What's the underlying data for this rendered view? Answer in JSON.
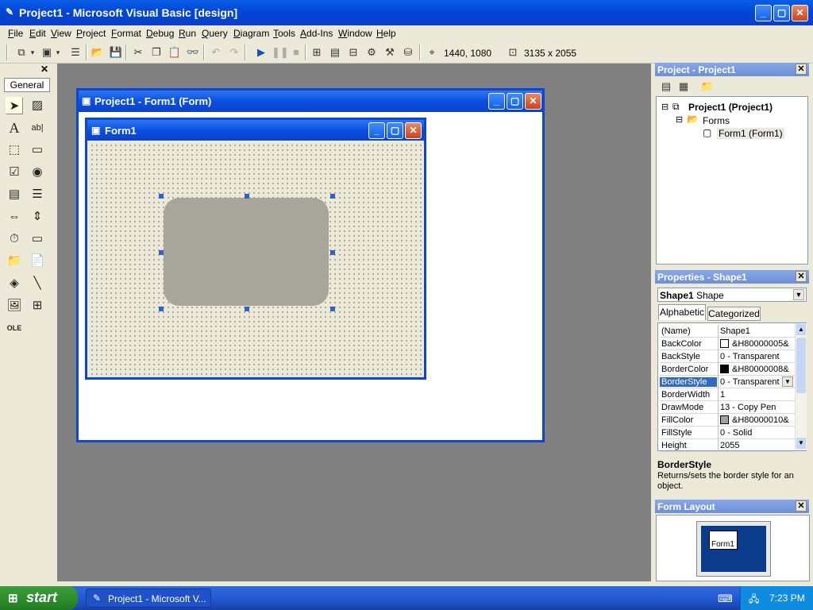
{
  "window": {
    "title": "Project1 - Microsoft Visual Basic [design]"
  },
  "menu": [
    "File",
    "Edit",
    "View",
    "Project",
    "Format",
    "Debug",
    "Run",
    "Query",
    "Diagram",
    "Tools",
    "Add-Ins",
    "Window",
    "Help"
  ],
  "toolbar": {
    "position": "1440, 1080",
    "size": "3135 x 2055"
  },
  "toolbox": {
    "tab_label": "General"
  },
  "designer": {
    "title": "Project1 - Form1 (Form)",
    "form_caption": "Form1"
  },
  "project_explorer": {
    "title": "Project - Project1",
    "root": "Project1 (Project1)",
    "folder": "Forms",
    "item": "Form1 (Form1)"
  },
  "properties": {
    "title": "Properties - Shape1",
    "object_name": "Shape1",
    "object_type": "Shape",
    "tab_alpha": "Alphabetic",
    "tab_cat": "Categorized",
    "rows": [
      {
        "name": "(Name)",
        "value": "Shape1"
      },
      {
        "name": "BackColor",
        "value": "&H80000005&",
        "swatch": "#ffffff"
      },
      {
        "name": "BackStyle",
        "value": "0 - Transparent"
      },
      {
        "name": "BorderColor",
        "value": "&H80000008&",
        "swatch": "#000000"
      },
      {
        "name": "BorderStyle",
        "value": "0 - Transparent"
      },
      {
        "name": "BorderWidth",
        "value": "1"
      },
      {
        "name": "DrawMode",
        "value": "13 - Copy Pen"
      },
      {
        "name": "FillColor",
        "value": "&H80000010&",
        "swatch": "#a0a0a0"
      },
      {
        "name": "FillStyle",
        "value": "0 - Solid"
      },
      {
        "name": "Height",
        "value": "2055"
      }
    ],
    "desc_title": "BorderStyle",
    "desc_text": "Returns/sets the border style for an object."
  },
  "form_layout": {
    "title": "Form Layout",
    "thumb_label": "Form1"
  },
  "taskbar": {
    "start": "start",
    "task": "Project1 - Microsoft V...",
    "clock": "7:23 PM"
  }
}
